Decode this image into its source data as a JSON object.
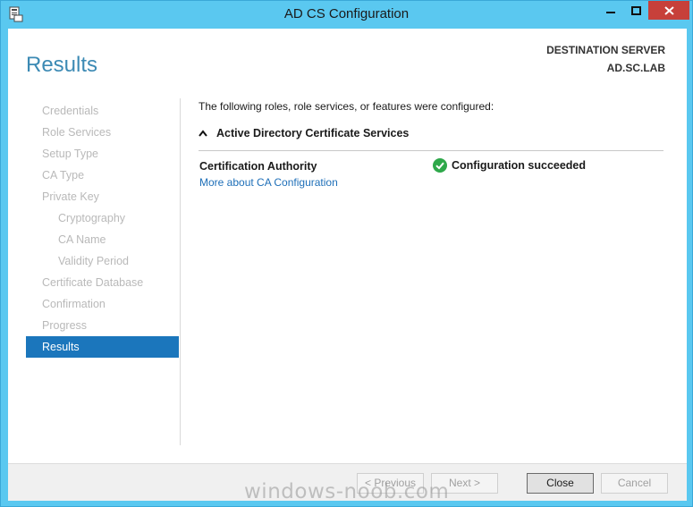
{
  "window": {
    "title": "AD CS Configuration"
  },
  "header": {
    "page_title": "Results",
    "destination_label": "DESTINATION SERVER",
    "destination_value": "AD.SC.LAB"
  },
  "nav": {
    "items": [
      {
        "label": "Credentials",
        "level": 0,
        "state": "inactive"
      },
      {
        "label": "Role Services",
        "level": 0,
        "state": "inactive"
      },
      {
        "label": "Setup Type",
        "level": 0,
        "state": "inactive"
      },
      {
        "label": "CA Type",
        "level": 0,
        "state": "inactive"
      },
      {
        "label": "Private Key",
        "level": 0,
        "state": "inactive"
      },
      {
        "label": "Cryptography",
        "level": 1,
        "state": "inactive"
      },
      {
        "label": "CA Name",
        "level": 1,
        "state": "inactive"
      },
      {
        "label": "Validity Period",
        "level": 1,
        "state": "inactive"
      },
      {
        "label": "Certificate Database",
        "level": 0,
        "state": "inactive"
      },
      {
        "label": "Confirmation",
        "level": 0,
        "state": "inactive"
      },
      {
        "label": "Progress",
        "level": 0,
        "state": "inactive"
      },
      {
        "label": "Results",
        "level": 0,
        "state": "active"
      }
    ]
  },
  "main": {
    "intro": "The following roles, role services, or features were configured:",
    "section_title": "Active Directory Certificate Services",
    "role": {
      "name": "Certification Authority",
      "status": "Configuration succeeded",
      "status_icon": "check-circle-icon",
      "link": "More about CA Configuration"
    }
  },
  "footer": {
    "previous_label": "< Previous",
    "next_label": "Next >",
    "close_label": "Close",
    "cancel_label": "Cancel"
  },
  "watermark": "windows-noob.com",
  "colors": {
    "title_bar": "#5ac8f0",
    "accent": "#3c8ab4",
    "nav_active": "#1b76bc",
    "link": "#1e6fb8",
    "success": "#2ea84a",
    "close_button": "#c7403a"
  }
}
